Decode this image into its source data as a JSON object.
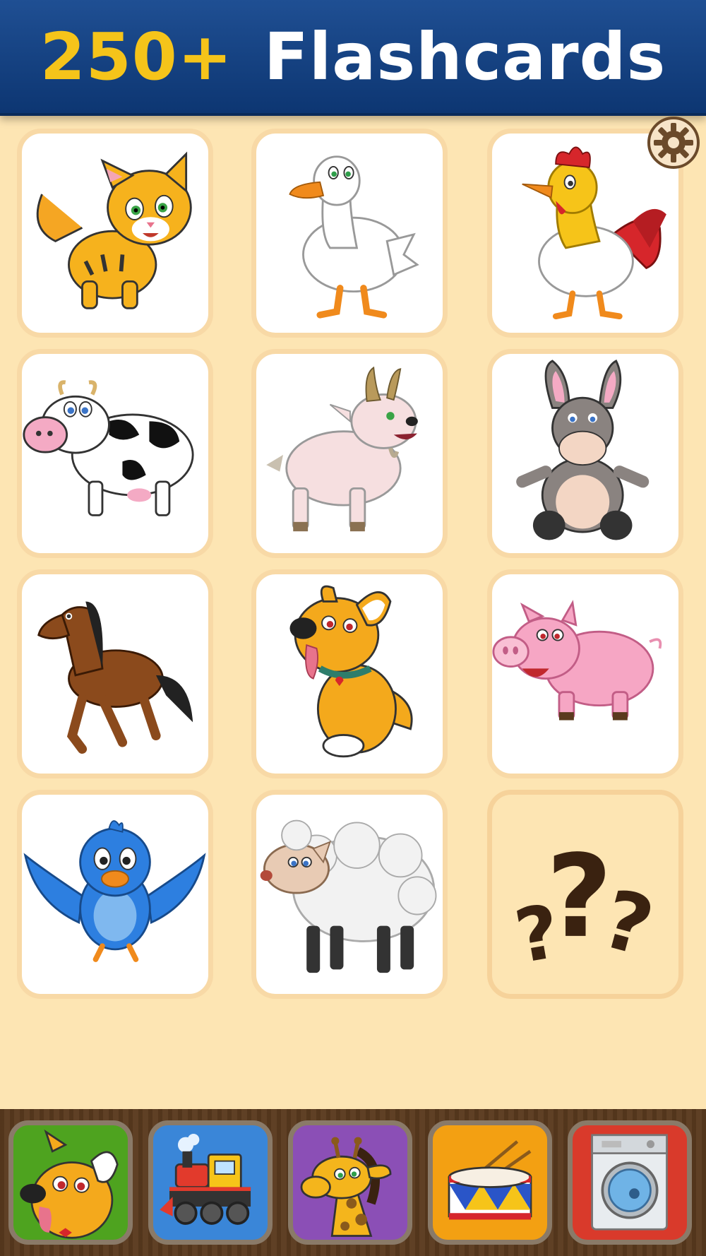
{
  "header": {
    "count": "250+",
    "word": "Flashcards"
  },
  "settings": {
    "icon": "gear-icon"
  },
  "cards": [
    {
      "name": "cat",
      "icon": "cat-icon"
    },
    {
      "name": "goose",
      "icon": "goose-icon"
    },
    {
      "name": "rooster",
      "icon": "rooster-icon"
    },
    {
      "name": "cow",
      "icon": "cow-icon"
    },
    {
      "name": "goat",
      "icon": "goat-icon"
    },
    {
      "name": "donkey",
      "icon": "donkey-icon"
    },
    {
      "name": "horse",
      "icon": "horse-icon"
    },
    {
      "name": "dog",
      "icon": "dog-icon"
    },
    {
      "name": "pig",
      "icon": "pig-icon"
    },
    {
      "name": "bird",
      "icon": "bird-icon"
    },
    {
      "name": "sheep",
      "icon": "sheep-icon"
    },
    {
      "name": "mystery",
      "icon": "question-marks-icon"
    }
  ],
  "dock": [
    {
      "name": "animals",
      "icon": "dog-icon",
      "color": "#4ea31f"
    },
    {
      "name": "vehicles",
      "icon": "train-icon",
      "color": "#3a86d8"
    },
    {
      "name": "zoo",
      "icon": "giraffe-icon",
      "color": "#8b4fb6"
    },
    {
      "name": "instruments",
      "icon": "drum-icon",
      "color": "#f3a012"
    },
    {
      "name": "household",
      "icon": "washing-machine-icon",
      "color": "#d93a2b"
    }
  ]
}
